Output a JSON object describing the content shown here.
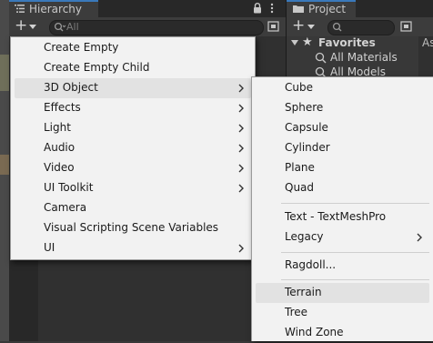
{
  "hierarchy": {
    "tab_label": "Hierarchy",
    "search_placeholder": "All"
  },
  "project": {
    "tab_label": "Project",
    "favorites_label": "Favorites",
    "favorites": [
      "All Materials",
      "All Models"
    ],
    "assets_clip": "As"
  },
  "create_menu": {
    "items": [
      {
        "label": "Create Empty",
        "submenu": false
      },
      {
        "label": "Create Empty Child",
        "submenu": false
      },
      {
        "label": "3D Object",
        "submenu": true,
        "highlighted": true
      },
      {
        "label": "Effects",
        "submenu": true
      },
      {
        "label": "Light",
        "submenu": true
      },
      {
        "label": "Audio",
        "submenu": true
      },
      {
        "label": "Video",
        "submenu": true
      },
      {
        "label": "UI Toolkit",
        "submenu": true
      },
      {
        "label": "Camera",
        "submenu": false
      },
      {
        "label": "Visual Scripting Scene Variables",
        "submenu": false
      },
      {
        "label": "UI",
        "submenu": true
      }
    ]
  },
  "object_submenu": {
    "items": [
      {
        "label": "Cube"
      },
      {
        "label": "Sphere"
      },
      {
        "label": "Capsule"
      },
      {
        "label": "Cylinder"
      },
      {
        "label": "Plane"
      },
      {
        "label": "Quad"
      },
      {
        "label": "Text - TextMeshPro"
      },
      {
        "label": "Legacy",
        "submenu": true
      },
      {
        "label": "Ragdoll..."
      },
      {
        "label": "Terrain",
        "highlighted": true
      },
      {
        "label": "Tree"
      },
      {
        "label": "Wind Zone"
      }
    ]
  }
}
